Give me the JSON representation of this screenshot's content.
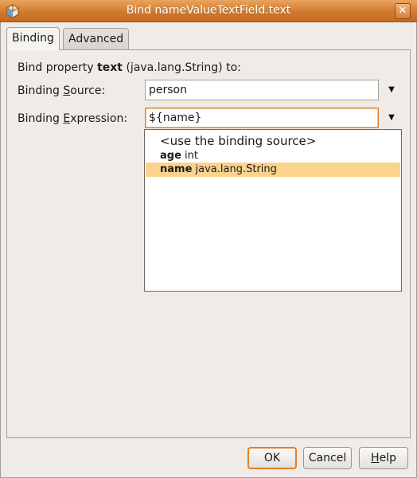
{
  "window": {
    "title": "Bind nameValueTextField.text"
  },
  "tabs": [
    {
      "label": "Binding",
      "active": true
    },
    {
      "label": "Advanced",
      "active": false
    }
  ],
  "binding": {
    "intro_prefix": "Bind property ",
    "property_name": "text",
    "intro_suffix": " (java.lang.String) to:",
    "source_label_prefix": "Binding ",
    "source_label_mnemonic": "S",
    "source_label_rest": "ource:",
    "source_value": "person",
    "expression_label_prefix": "Binding ",
    "expression_label_mnemonic": "E",
    "expression_label_rest": "xpression:",
    "expression_value": "${name}"
  },
  "dropdown": {
    "items": [
      {
        "bold": "",
        "text": "<use the binding source>"
      },
      {
        "bold": "age",
        "text": " int"
      },
      {
        "bold": "name",
        "text": " java.lang.String",
        "selected": true
      }
    ]
  },
  "buttons": {
    "ok": "OK",
    "cancel": "Cancel",
    "help_mnemonic": "H",
    "help_rest": "elp"
  },
  "icons": {
    "app": "app-icon",
    "close": "close-icon",
    "dropdown_arrow": "chevron-down-icon"
  },
  "colors": {
    "titlebar": "#d17a2e",
    "focus": "#e07f2c",
    "selection": "#fbd38d"
  }
}
